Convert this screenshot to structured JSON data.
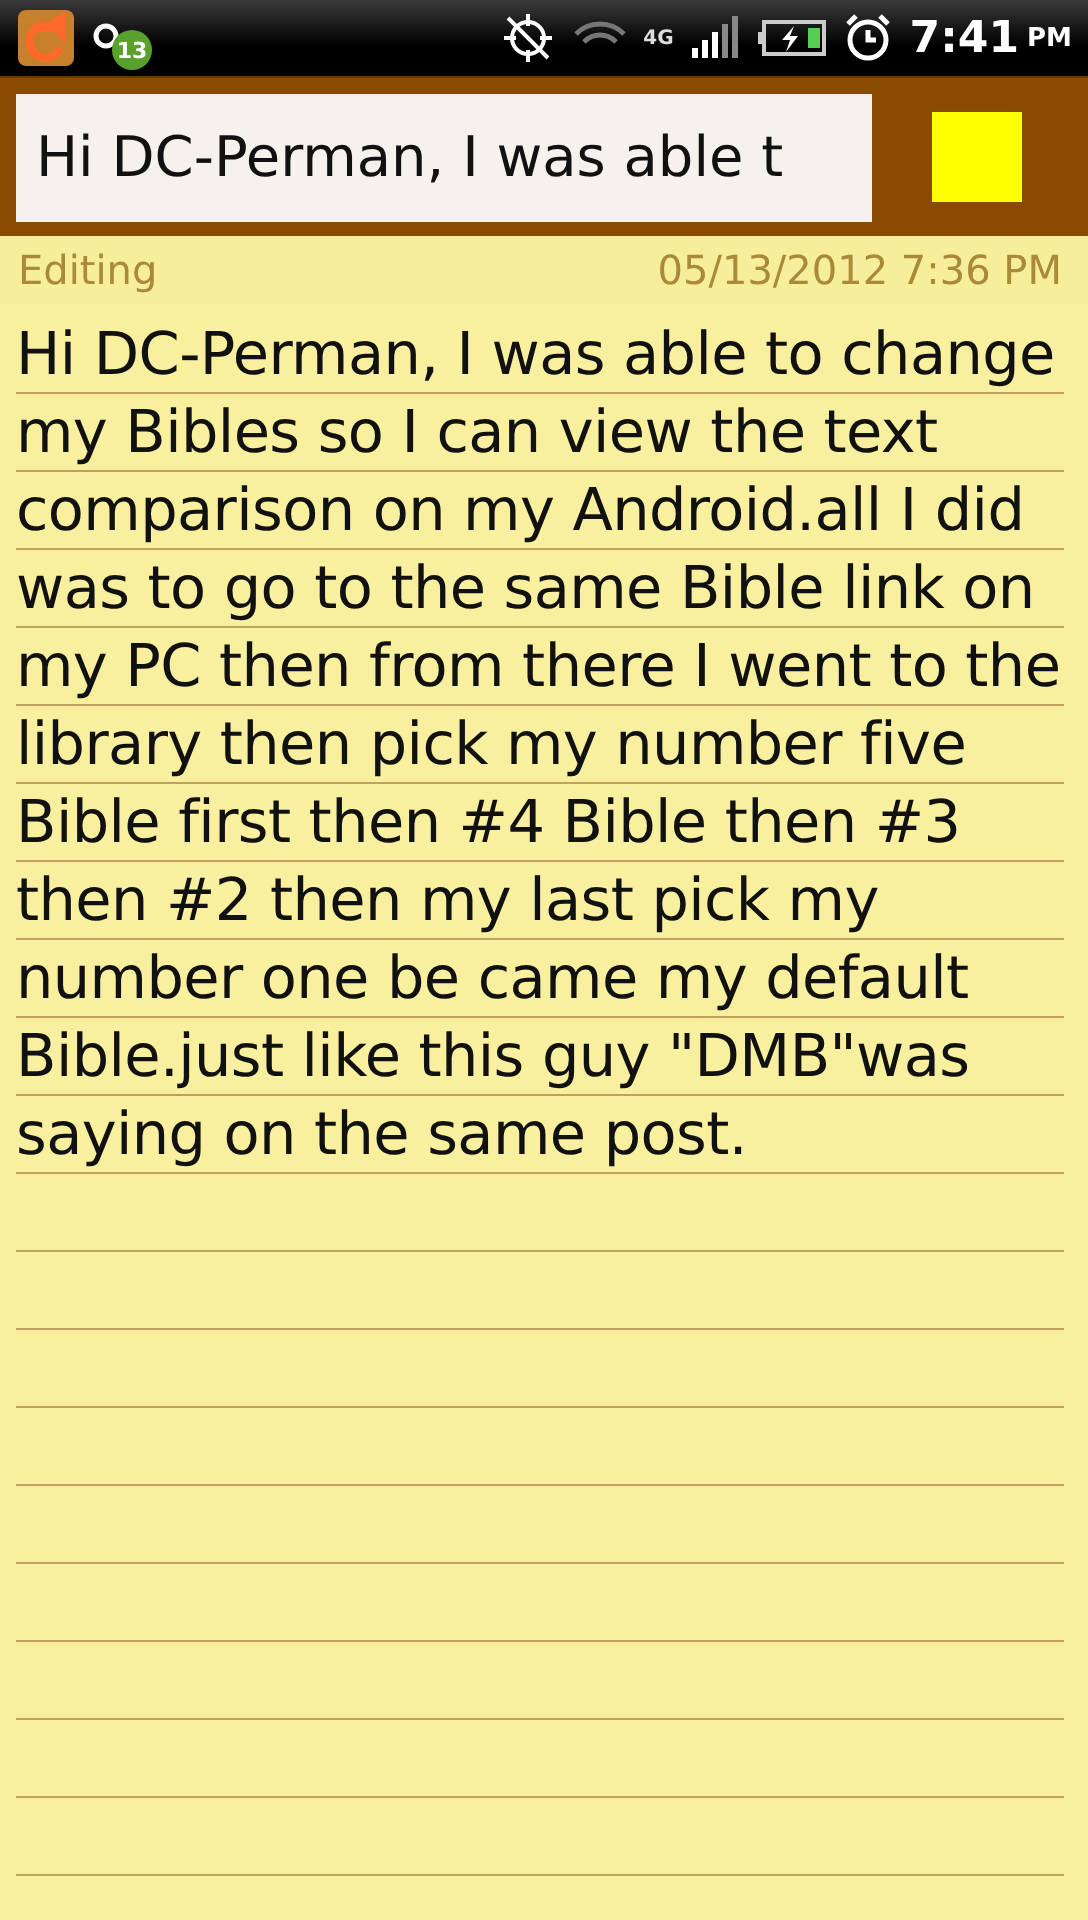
{
  "status_bar": {
    "notification_count": "13",
    "network": "4G",
    "time": "7:41",
    "meridiem": "PM"
  },
  "header": {
    "title_field": "Hi DC-Perman, I was able t"
  },
  "meta": {
    "mode": "Editing",
    "timestamp": "05/13/2012 7:36 PM"
  },
  "note": {
    "body": "Hi DC-Perman, I was able to change my Bibles so I can view the text comparison on my Android.all I did was to go to the same Bible link on my PC then from there I went to the library then pick my number five Bible first then #4 Bible then #3 then #2 then my last pick my number one be came my default Bible.just like this guy \"DMB\"was saying on the same post."
  }
}
